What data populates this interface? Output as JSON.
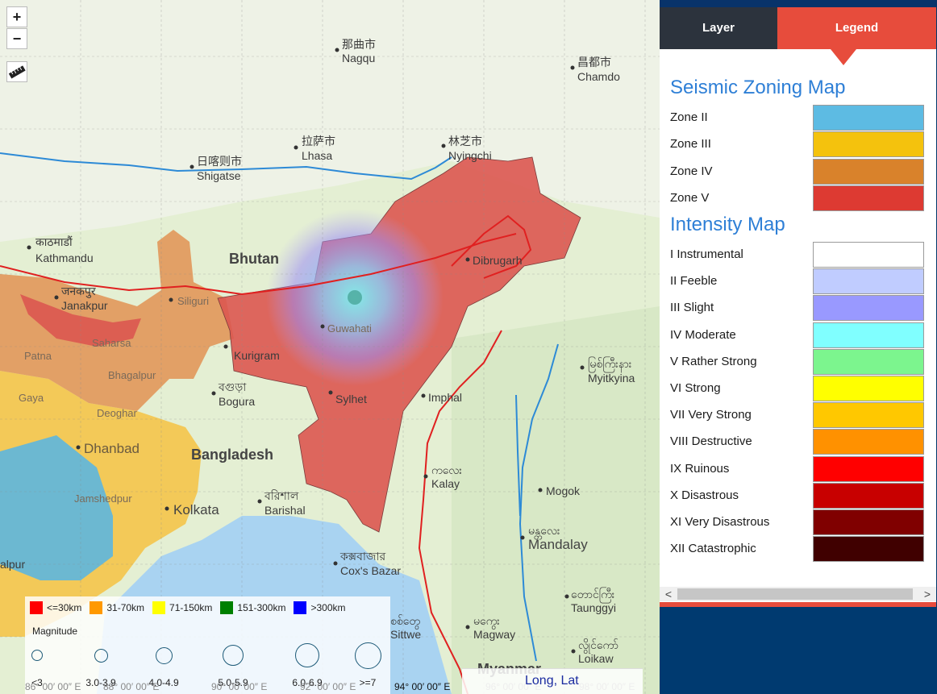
{
  "zoom": {
    "in_label": "+",
    "out_label": "−"
  },
  "map": {
    "labels": [
      {
        "id": "nagqu",
        "text": "那曲市\nNagqu"
      },
      {
        "id": "chamdo",
        "text": "昌都市\nChamdo"
      },
      {
        "id": "lhasa",
        "text": "拉萨市\nLhasa"
      },
      {
        "id": "nyingchi",
        "text": "林芝市\nNyingchi"
      },
      {
        "id": "shigatse",
        "text": "日喀则市\nShigatse"
      },
      {
        "id": "kathmandu",
        "text": "काठमाडौं\nKathmandu"
      },
      {
        "id": "bhutan",
        "text": "Bhutan"
      },
      {
        "id": "dibrugarh",
        "text": "Dibrugarh"
      },
      {
        "id": "janakpur",
        "text": "जनकपुर\nJanakpur"
      },
      {
        "id": "siliguri",
        "text": "Siliguri"
      },
      {
        "id": "guwahati",
        "text": "Guwahati"
      },
      {
        "id": "kurigram",
        "text": "Kurigram"
      },
      {
        "id": "saharsa",
        "text": "Saharsa"
      },
      {
        "id": "patna",
        "text": "Patna"
      },
      {
        "id": "bhagalpur",
        "text": "Bhagalpur"
      },
      {
        "id": "bogura",
        "text": "বগুড়া\nBogura"
      },
      {
        "id": "sylhet",
        "text": "Sylhet"
      },
      {
        "id": "imphal",
        "text": "Imphal"
      },
      {
        "id": "myitkyina",
        "text": "မြစ်ကြီးနား\nMyitkyina"
      },
      {
        "id": "gaya",
        "text": "Gaya"
      },
      {
        "id": "deoghar",
        "text": "Deoghar"
      },
      {
        "id": "dhanbad",
        "text": "Dhanbad"
      },
      {
        "id": "bangladesh",
        "text": "Bangladesh"
      },
      {
        "id": "kalay",
        "text": "ကလေး\nKalay"
      },
      {
        "id": "mogok",
        "text": "Mogok"
      },
      {
        "id": "jamshedpur",
        "text": "Jamshedpur"
      },
      {
        "id": "kolkata",
        "text": "Kolkata"
      },
      {
        "id": "barishal",
        "text": "বরিশাল\nBarishal"
      },
      {
        "id": "mandalay",
        "text": "မန္တလေး\nMandalay"
      },
      {
        "id": "coxsbazar",
        "text": "কক্সবাজার\nCox's Bazar"
      },
      {
        "id": "taunggyi",
        "text": "တောင်ကြီး\nTaunggyi"
      },
      {
        "id": "sittwe",
        "text": "စစ်တွေ\nSittwe"
      },
      {
        "id": "magway",
        "text": "မကွေး\nMagway"
      },
      {
        "id": "loikaw",
        "text": "လွိုင်ကော်\nLoikaw"
      },
      {
        "id": "myanmar",
        "text": "Myanmar"
      },
      {
        "id": "balpur",
        "text": "alpur"
      }
    ],
    "coordinates": [
      {
        "id": "c1",
        "text": "86° 00′ 00″ E"
      },
      {
        "id": "c2",
        "text": "88° 00′ 00″ E"
      },
      {
        "id": "c3",
        "text": "90° 00′ 00″ E"
      },
      {
        "id": "c4",
        "text": "92° 00′ 00″ E"
      },
      {
        "id": "c5",
        "text": "94° 00′ 00″ E"
      },
      {
        "id": "c6",
        "text": "96° 00′ 00″ E"
      },
      {
        "id": "c7",
        "text": "98° 00′ 00″ E"
      }
    ],
    "longlat_label": "Long, Lat"
  },
  "depth_legend": [
    {
      "label": "<=30km",
      "color": "#ff0000"
    },
    {
      "label": "31-70km",
      "color": "#ff9900"
    },
    {
      "label": "71-150km",
      "color": "#ffff00"
    },
    {
      "label": "151-300km",
      "color": "#008000"
    },
    {
      "label": ">300km",
      "color": "#0000ff"
    }
  ],
  "magnitude": {
    "title": "Magnitude",
    "items": [
      {
        "label": "<3",
        "size": 12
      },
      {
        "label": "3.0-3.9",
        "size": 15
      },
      {
        "label": "4.0-4.9",
        "size": 19
      },
      {
        "label": "5.0-5.9",
        "size": 24
      },
      {
        "label": "6.0-6.9",
        "size": 28
      },
      {
        "label": ">=7",
        "size": 31
      }
    ]
  },
  "panel": {
    "tab_layer": "Layer",
    "tab_legend": "Legend",
    "seismic_title": "Seismic Zoning Map",
    "zones": [
      {
        "name": "Zone II",
        "color": "#5dbbe3"
      },
      {
        "name": "Zone III",
        "color": "#f4c20d"
      },
      {
        "name": "Zone IV",
        "color": "#d9822b"
      },
      {
        "name": "Zone V",
        "color": "#dd3a32"
      }
    ],
    "intensity_title": "Intensity Map",
    "intensities": [
      {
        "name": "I Instrumental",
        "color": "#ffffff"
      },
      {
        "name": "II Feeble",
        "color": "#c0ccff"
      },
      {
        "name": "III Slight",
        "color": "#9999ff"
      },
      {
        "name": "IV Moderate",
        "color": "#80ffff"
      },
      {
        "name": "V Rather Strong",
        "color": "#7cf58e"
      },
      {
        "name": "VI Strong",
        "color": "#ffff00"
      },
      {
        "name": "VII Very Strong",
        "color": "#ffc800"
      },
      {
        "name": "VIII Destructive",
        "color": "#ff9100"
      },
      {
        "name": "IX Ruinous",
        "color": "#ff0000"
      },
      {
        "name": "X Disastrous",
        "color": "#c80000"
      },
      {
        "name": "XI Very Disastrous",
        "color": "#800000"
      },
      {
        "name": "XII Catastrophic",
        "color": "#400000"
      }
    ],
    "scroll_left": "<",
    "scroll_right": ">"
  }
}
